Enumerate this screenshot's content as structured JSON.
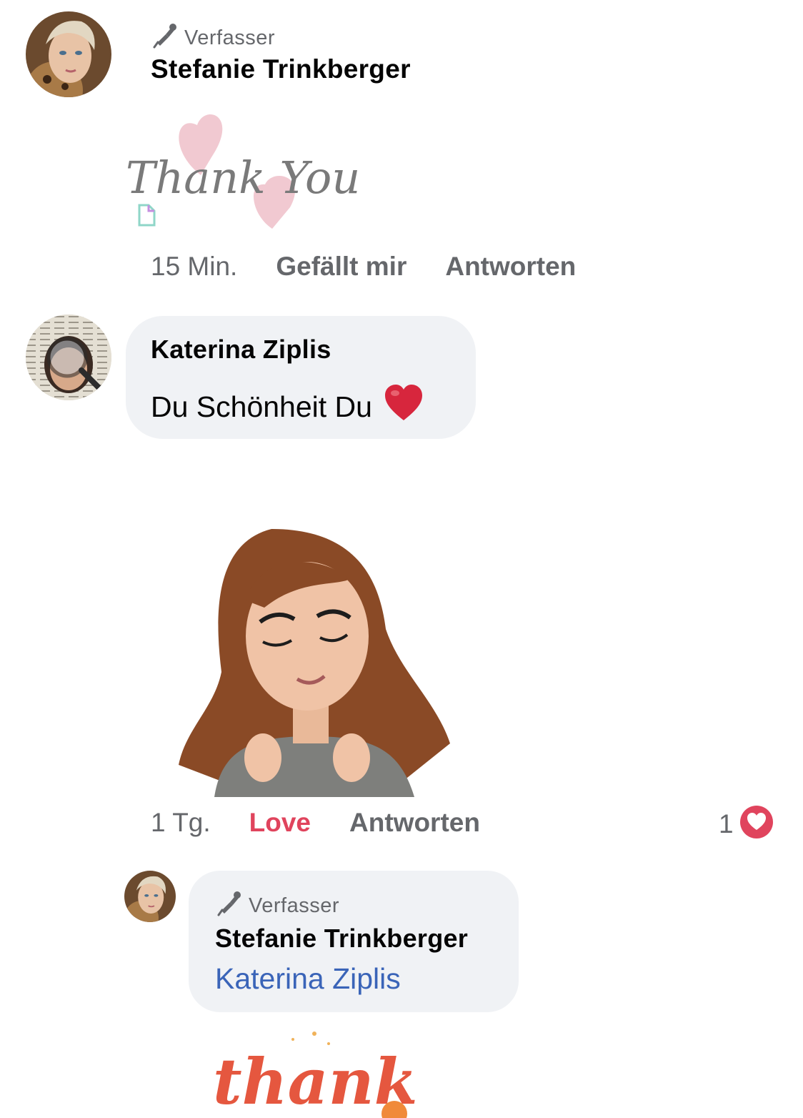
{
  "comments": [
    {
      "badge": "Verfasser",
      "author": "Stefanie Trinkberger",
      "sticker": "Thank You",
      "time": "15 Min.",
      "like_label": "Gefällt mir",
      "reply_label": "Antworten"
    },
    {
      "author": "Katerina Ziplis",
      "text": "Du Schönheit Du",
      "emoji": "❤️",
      "time": "1 Tg.",
      "like_label": "Love",
      "reply_label": "Antworten",
      "reaction_count": "1"
    },
    {
      "badge": "Verfasser",
      "author": "Stefanie Trinkberger",
      "mention": "Katerina Ziplis",
      "sticker": "thank"
    }
  ],
  "colors": {
    "bubble": "#f0f2f5",
    "meta": "#65676b",
    "love": "#e0445d",
    "mention": "#3a64b8",
    "heart_pink": "#efc3cc"
  },
  "icons": [
    "pen-icon",
    "heart-reaction-icon"
  ]
}
